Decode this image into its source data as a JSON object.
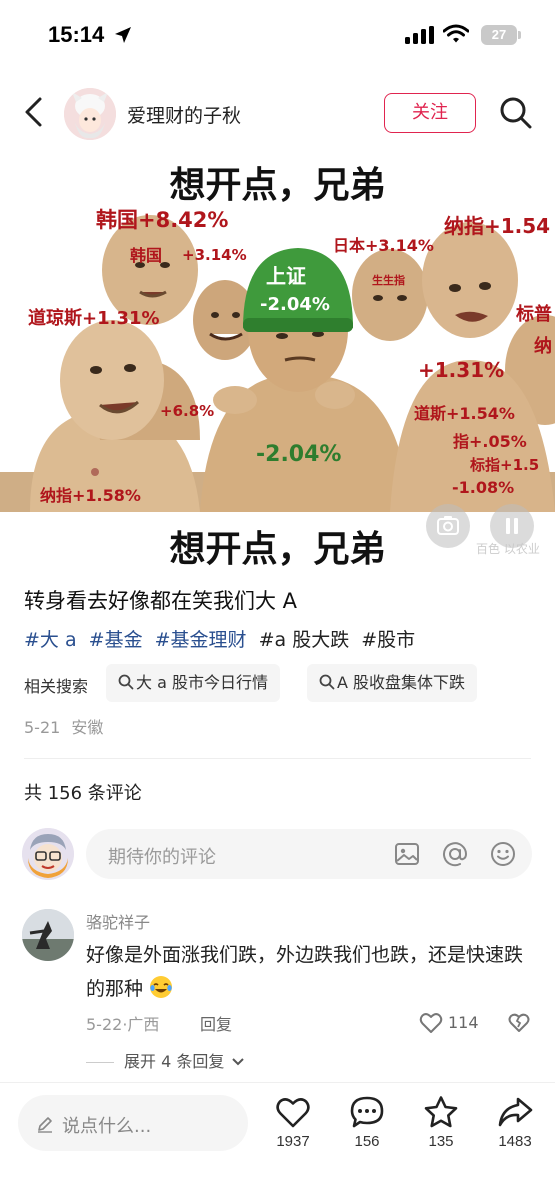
{
  "status_bar": {
    "time": "15:14",
    "battery": "27"
  },
  "header": {
    "author": "爱理财的子秋",
    "follow_label": "关注"
  },
  "image": {
    "caption_top": "想开点，兄弟",
    "caption_bottom": "想开点，兄弟",
    "labels": {
      "korea_big": "韩国+8.42%",
      "korea_small": "韩国",
      "korea_small_pct": "+3.14%",
      "shanghai": "上证",
      "shanghai_pct": "-2.04%",
      "japan": "日本+3.14%",
      "nasdaq_right": "纳指+1.54",
      "dow": "道琼斯+1.31%",
      "sp": "标普",
      "na": "纳",
      "gem": "生生指",
      "plus131": "+1.31%",
      "plus68": "+6.8%",
      "minus204": "-2.04%",
      "dow2": "道斯+1.54%",
      "zhi": "指+.05%",
      "biaozhi": "标指+1.5",
      "minus108": "-1.08%",
      "nasdaq_left": "纳指+1.58%"
    },
    "watermark": "百色 以农业"
  },
  "post": {
    "title": "转身看去好像都在笑我们大 A",
    "tags": [
      {
        "text": "#大 a",
        "style": "blue"
      },
      {
        "text": "#基金",
        "style": "blue"
      },
      {
        "text": "#基金理财",
        "style": "blue"
      },
      {
        "text": "#a 股大跌",
        "style": "dark"
      },
      {
        "text": "#股市",
        "style": "dark"
      }
    ],
    "related_label": "相关搜索",
    "related": [
      "大 a 股市今日行情",
      "A 股收盘集体下跌"
    ],
    "date": "5-21",
    "location": "安徽"
  },
  "comments": {
    "count_text": "共 156 条评论",
    "input_placeholder": "期待你的评论",
    "items": [
      {
        "author": "骆驼祥子",
        "text": "好像是外面涨我们跌，外边跌我们也跌，还是快速跌的那种",
        "date": "5-22",
        "location": "广西",
        "reply_label": "回复",
        "likes": "114",
        "expand_label": "展开 4 条回复"
      }
    ]
  },
  "bottom_bar": {
    "input_placeholder": "说点什么...",
    "likes": "1937",
    "comments": "156",
    "stars": "135",
    "shares": "1483"
  },
  "colors": {
    "accent": "#e0244f",
    "tag_blue": "#2a4f8f",
    "red_label": "#b0161c",
    "green_label": "#2e7d2e"
  }
}
